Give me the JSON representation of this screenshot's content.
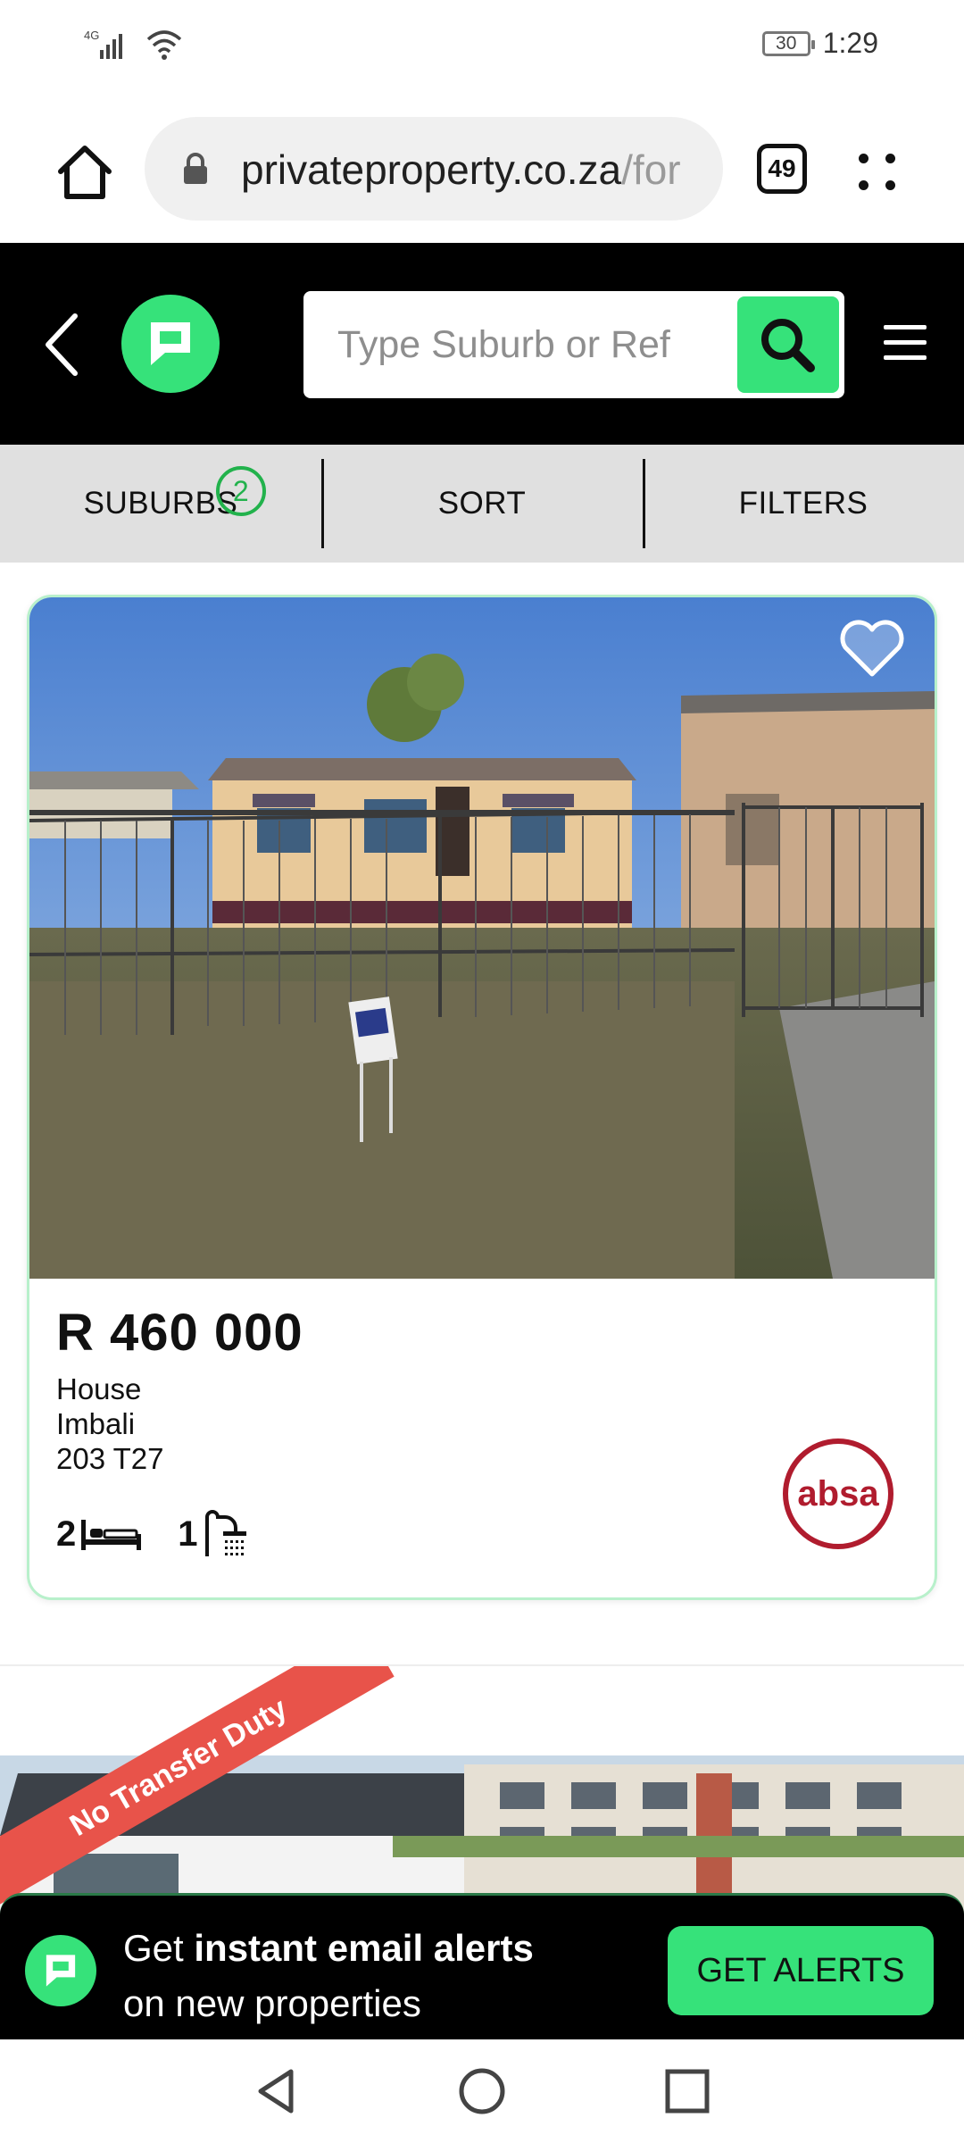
{
  "status_bar": {
    "network": "4G",
    "battery": "30",
    "time": "1:29"
  },
  "browser": {
    "url_main": "privateproperty.co.za",
    "url_tail": "/for",
    "tab_count": "49"
  },
  "header": {
    "search_placeholder": "Type Suburb or Ref"
  },
  "filters": {
    "suburbs_label": "SUBURBS",
    "suburbs_count": "2",
    "sort_label": "SORT",
    "filters_label": "FILTERS"
  },
  "listing": {
    "price": "R 460 000",
    "type": "House",
    "suburb": "Imbali",
    "address": "203 T27",
    "bedrooms": "2",
    "bathrooms": "1",
    "agency_logo": "absa"
  },
  "listing2": {
    "ribbon": "No Transfer Duty"
  },
  "alert_banner": {
    "text_prefix": "Get ",
    "text_bold": "instant email alerts",
    "text_line2": "on new properties",
    "button_label": "GET ALERTS"
  },
  "colors": {
    "brand_green": "#36e27a",
    "header_black": "#000000",
    "absa_red": "#b01c2e",
    "ribbon_red": "#e8534a"
  }
}
